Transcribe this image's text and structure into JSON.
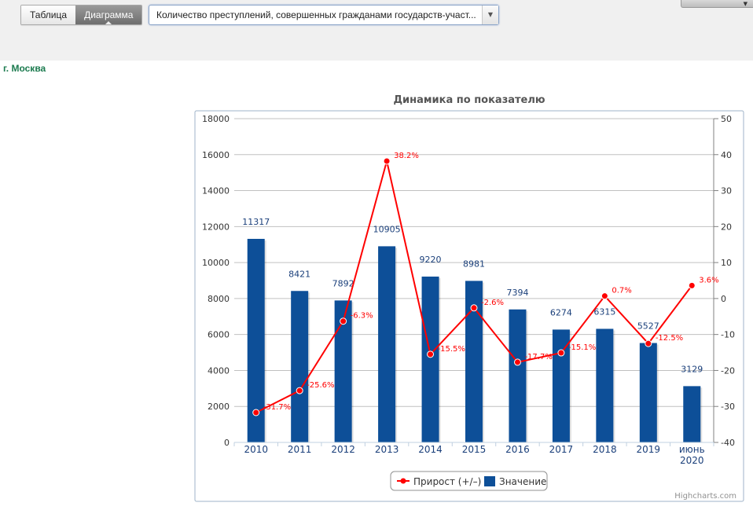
{
  "toolbar": {
    "tabs": [
      {
        "label": "Таблица",
        "active": false
      },
      {
        "label": "Диаграмма",
        "active": true
      }
    ],
    "indicator_select": {
      "value": "Количество преступлений, совершенных гражданами государств-участ..."
    }
  },
  "region": "г. Москва",
  "credits": "Highcharts.com",
  "colors": {
    "bars": "#0d4f98",
    "line": "#ff0000",
    "region": "#1c7b4f"
  },
  "chart_data": {
    "type": "bar",
    "title": "Динамика по показателю",
    "categories": [
      "2010",
      "2011",
      "2012",
      "2013",
      "2014",
      "2015",
      "2016",
      "2017",
      "2018",
      "2019",
      "июнь 2020"
    ],
    "series": [
      {
        "name": "Значение",
        "type": "bar",
        "axis": "left",
        "values": [
          11317,
          8421,
          7892,
          10905,
          9220,
          8981,
          7394,
          6274,
          6315,
          5527,
          3129
        ],
        "labels": [
          "11317",
          "8421",
          "7892",
          "10905",
          "9220",
          "8981",
          "7394",
          "6274",
          "6315",
          "5527",
          "3129"
        ]
      },
      {
        "name": "Прирост (+/–)",
        "type": "line",
        "axis": "right",
        "values": [
          -31.7,
          -25.6,
          -6.3,
          38.2,
          -15.5,
          -2.6,
          -17.7,
          -15.1,
          0.7,
          -12.5,
          3.6
        ],
        "labels": [
          "-31.7%",
          "-25.6%",
          "-6.3%",
          "38.2%",
          "-15.5%",
          "-2.6%",
          "-17.7%",
          "-15.1%",
          "0.7%",
          "-12.5%",
          "3.6%"
        ]
      }
    ],
    "y_left": {
      "min": 0,
      "max": 18000,
      "ticks": [
        0,
        2000,
        4000,
        6000,
        8000,
        10000,
        12000,
        14000,
        16000,
        18000
      ]
    },
    "y_right": {
      "min": -40,
      "max": 50,
      "ticks": [
        -40,
        -30,
        -20,
        -10,
        0,
        10,
        20,
        30,
        40,
        50
      ]
    },
    "legend": {
      "position": "bottom-center",
      "items": [
        "Прирост (+/–)",
        "Значение"
      ]
    },
    "grid": true
  }
}
